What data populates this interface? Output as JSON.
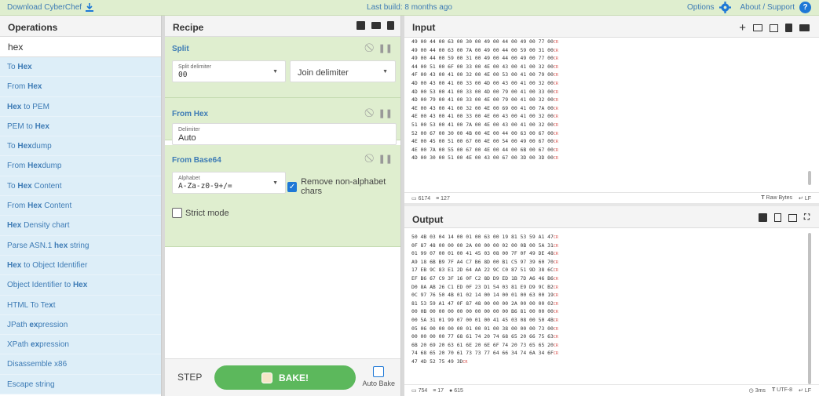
{
  "banner": {
    "download": "Download CyberChef",
    "build": "Last build: 8 months ago",
    "options": "Options",
    "about": "About / Support"
  },
  "operations": {
    "title": "Operations",
    "search_value": "hex",
    "items": [
      {
        "pre": "To ",
        "hl": "Hex",
        "post": ""
      },
      {
        "pre": "From ",
        "hl": "Hex",
        "post": ""
      },
      {
        "pre": "",
        "hl": "Hex",
        "post": " to PEM"
      },
      {
        "pre": "PEM to ",
        "hl": "Hex",
        "post": ""
      },
      {
        "pre": "To ",
        "hl": "Hex",
        "post": "dump"
      },
      {
        "pre": "From ",
        "hl": "Hex",
        "post": "dump"
      },
      {
        "pre": "To ",
        "hl": "Hex",
        "post": " Content"
      },
      {
        "pre": "From ",
        "hl": "Hex",
        "post": " Content"
      },
      {
        "pre": "",
        "hl": "Hex",
        "post": " Density chart"
      },
      {
        "pre": "Parse ASN.1 ",
        "hl": "hex",
        "post": " string"
      },
      {
        "pre": "",
        "hl": "Hex",
        "post": " to Object Identifier"
      },
      {
        "pre": "Object Identifier to ",
        "hl": "Hex",
        "post": ""
      },
      {
        "pre": "HTML To Te",
        "hl": "x",
        "post": "t"
      },
      {
        "pre": "JPath ",
        "hl": "ex",
        "post": "pression"
      },
      {
        "pre": "XPath ",
        "hl": "ex",
        "post": "pression"
      },
      {
        "pre": "Disassemble x86",
        "hl": "",
        "post": ""
      },
      {
        "pre": "Escape string",
        "hl": "",
        "post": ""
      }
    ]
  },
  "recipe": {
    "title": "Recipe",
    "split": {
      "name": "Split",
      "delim_label": "Split delimiter",
      "delim_value": "00",
      "join_label": "Join delimiter"
    },
    "fromhex": {
      "name": "From Hex",
      "delim_label": "Delimiter",
      "delim_value": "Auto"
    },
    "frombase64": {
      "name": "From Base64",
      "alpha_label": "Alphabet",
      "alpha_value": "A-Za-z0-9+/=",
      "remove_label": "Remove non-alphabet chars",
      "strict_label": "Strict mode"
    },
    "step": "STEP",
    "bake": "BAKE!",
    "autobake": "Auto Bake"
  },
  "input": {
    "title": "Input",
    "lines": [
      "49 00 44 00 63 00 30 00 49 00 44 00 49 00 77 00",
      "49 00 44 00 63 00 7A 00 49 00 44 00 59 00 31 00",
      "49 00 44 00 59 00 31 00 49 00 44 00 49 00 77 00",
      "44 00 51 00 6F 00 33 00 4E 00 43 00 41 00 32 00",
      "4F 00 43 00 41 00 32 00 4E 00 53 00 41 00 79 00",
      "4D 00 43 00 41 00 33 00 4D 00 43 00 41 00 32 00",
      "4D 00 53 00 41 00 33 00 4D 00 79 00 41 00 33 00",
      "4D 00 79 00 41 00 33 00 4E 00 79 00 41 00 32 00",
      "4E 00 43 00 41 00 32 00 4E 00 69 00 41 00 7A 00",
      "4E 00 43 00 41 00 33 00 4E 00 43 00 41 00 32 00",
      "51 00 53 00 41 00 7A 00 4E 00 43 00 41 00 32 00",
      "52 00 67 00 30 00 4B 00 4E 00 44 00 63 00 67 00",
      "4E 00 45 00 51 00 67 00 4E 00 54 00 49 00 67 00",
      "4E 00 7A 00 55 00 67 00 4E 00 44 00 6B 00 67 00",
      "4D 00 30 00 51 00 4E 00 43 00 67 00 3D 00 3D 00"
    ],
    "status_length": "6174",
    "status_lines": "127",
    "raw_bytes": "Raw Bytes",
    "eol": "LF"
  },
  "output": {
    "title": "Output",
    "lines": [
      "50 4B 03 04 14 00 01 00 63 00 19 81 53 59 A1 47",
      "0F 87 48 00 00 00 2A 00 00 00 02 00 0B 00 5A 31",
      "01 99 07 00 01 00 41 45 03 08 00 7F 0F 49 DE 48",
      "A9 18 6B B9 7F A4 C7 B6 8D 00 B1 C5 97 39 60 70",
      "17 EB 9C 83 E1 2D 64 AA 22 9C C0 87 51 9D 38 6C",
      "EF B6 67 C9 3F 16 0F C2 8D D9 ED 1B 7D A6 46 B6",
      "D0 8A AB 26 C1 ED 0F 23 D1 54 03 81 E9 D9 9C B2",
      "0C 97 76 50 4B 01 02 14 00 14 00 01 00 63 00 19",
      "81 53 59 A1 47 0F 87 48 00 00 00 2A 00 00 00 02",
      "00 0B 00 00 00 00 00 00 00 00 00 B6 81 00 00 00",
      "00 5A 31 01 99 07 00 01 00 41 45 03 08 00 50 4B",
      "05 06 00 00 00 00 01 00 01 00 38 00 00 00 73 00",
      "00 00 00 00 77 68 61 74 20 74 68 65 20 66 75 63",
      "6B 20 69 20 63 61 6E 20 6E 6F 74 20 73 65 65 20",
      "74 68 65 20 70 61 73 73 77 64 66 34 74 6A 34 6F",
      "47 4D 52 75 49 3D"
    ],
    "status_length": "754",
    "status_lines": "17",
    "status_pos": "615",
    "time": "3ms",
    "encoding": "UTF-8",
    "eol": "LF"
  },
  "colors": {
    "banner": "#dfeecf",
    "ops_bg": "#ddeef8",
    "link": "#3d7bb5",
    "bake": "#5cb85c",
    "crlf": "#d9534f"
  }
}
